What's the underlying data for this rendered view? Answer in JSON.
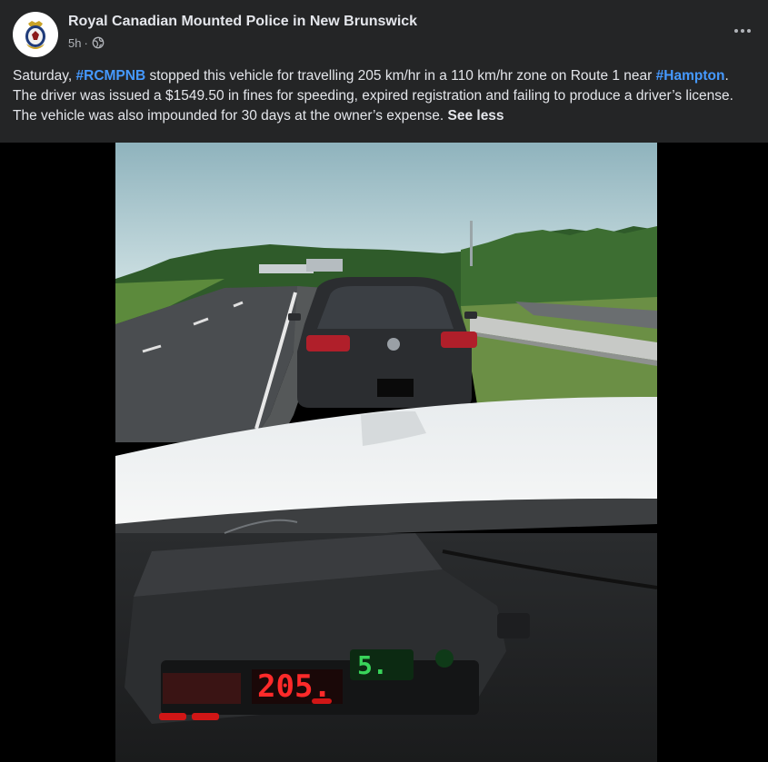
{
  "post": {
    "page_name": "Royal Canadian Mounted Police in New Brunswick",
    "timestamp": "5h",
    "separator": "·",
    "audience_icon": "globe-icon",
    "more_icon": "more-options-icon",
    "text": {
      "part1": "Saturday, ",
      "hashtag1": "#RCMPNB",
      "part2": " stopped this vehicle for travelling 205 km/hr in a 110 km/hr zone on Route 1 near ",
      "hashtag2": "#Hampton",
      "part3": ". The driver was issued a $1549.50 in fines for speeding, expired registration and failing to produce a driver’s license. The vehicle was also impounded for 30 days at the owner’s expense. ",
      "see_less": "See less"
    }
  },
  "photo": {
    "radar_main_reading": "205.",
    "radar_secondary_reading": "5."
  },
  "colors": {
    "background": "#18191a",
    "card": "#242526",
    "link": "#4599ff",
    "text_primary": "#e4e6eb",
    "text_secondary": "#b0b3b8"
  }
}
